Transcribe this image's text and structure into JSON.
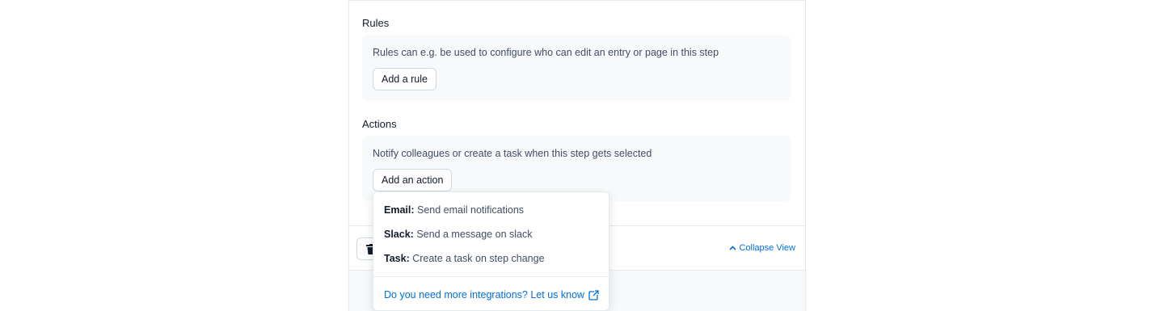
{
  "rules": {
    "title": "Rules",
    "description": "Rules can e.g. be used to configure who can edit an entry or page in this step",
    "add_button": "Add a rule"
  },
  "actions": {
    "title": "Actions",
    "description": "Notify colleagues or create a task when this step gets selected",
    "add_button": "Add an action"
  },
  "footer": {
    "delete_icon": "trash-icon",
    "collapse_label": "Collapse View",
    "collapse_icon": "chevron-up-icon"
  },
  "action_menu": {
    "items": [
      {
        "type": "Email:",
        "text": "Send email notifications"
      },
      {
        "type": "Slack:",
        "text": "Send a message on slack"
      },
      {
        "type": "Task:",
        "text": "Create a task on step change"
      }
    ],
    "link_label": "Do you need more integrations? Let us know",
    "link_icon": "external-link-icon"
  },
  "colors": {
    "accent": "#036fe3",
    "text": "#414d63",
    "heading": "#111b2b",
    "muted_bg": "#f7f9fa",
    "border": "#cfd9e0"
  }
}
